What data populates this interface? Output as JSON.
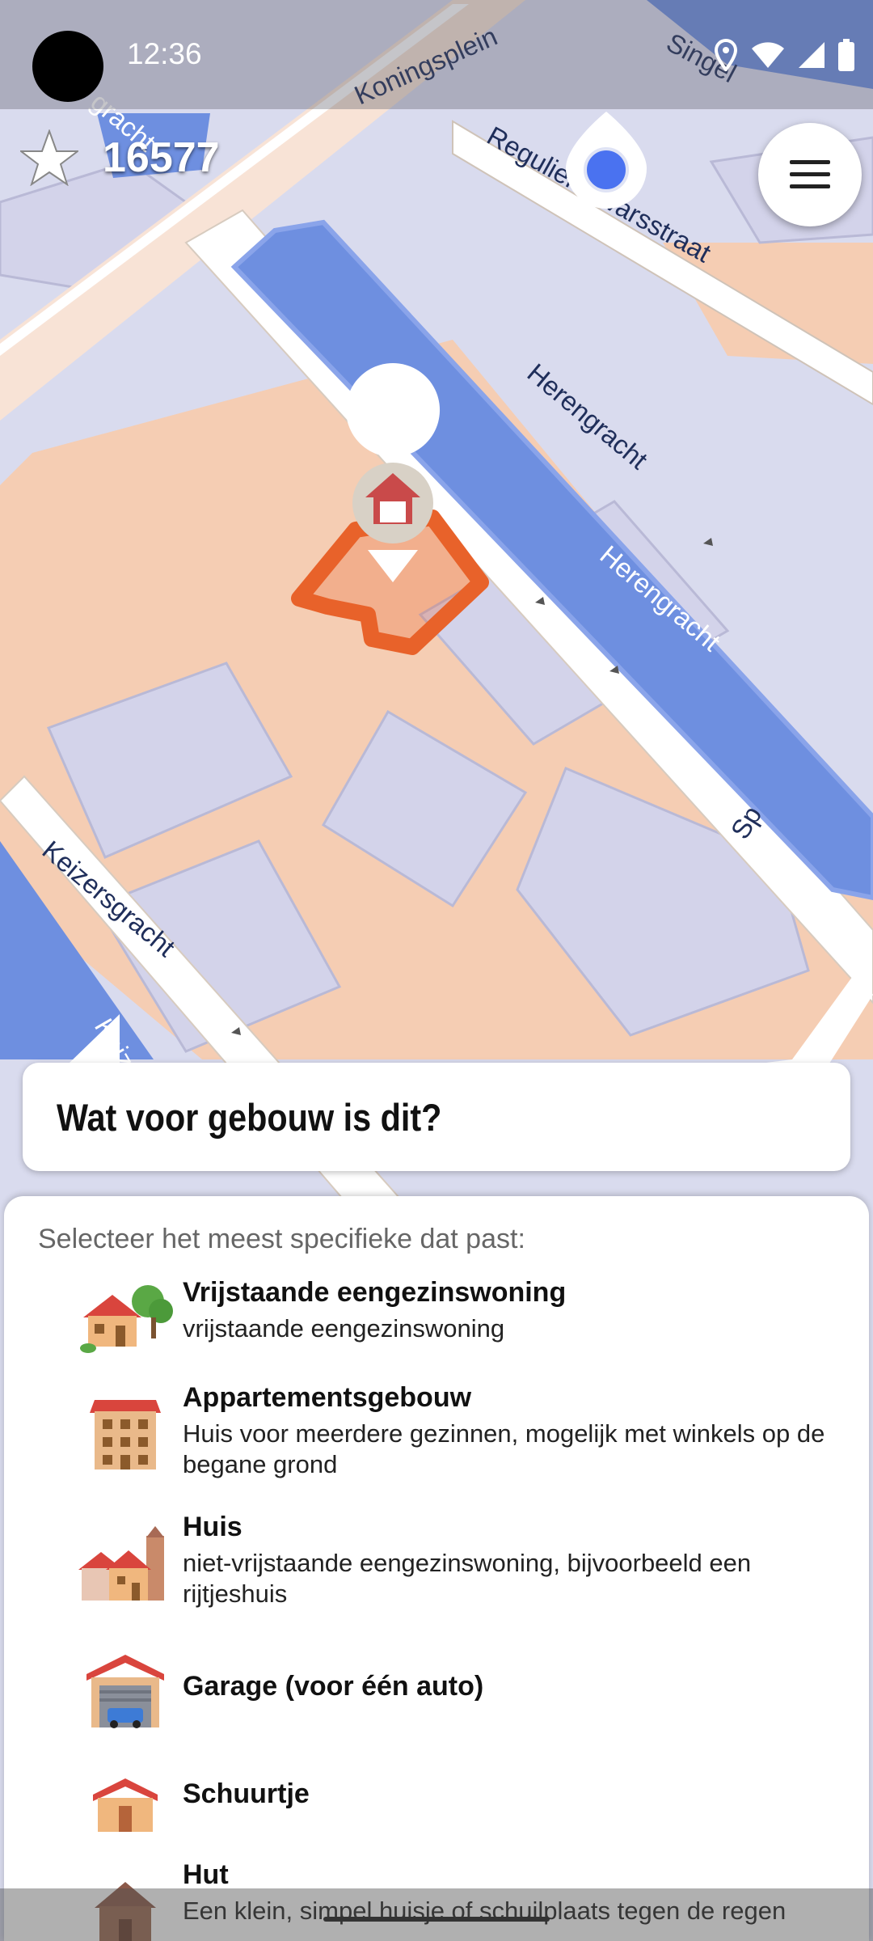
{
  "status": {
    "time": "12:36"
  },
  "points": {
    "value": "16577"
  },
  "map": {
    "streets": {
      "koningsplein": "Koningsplein",
      "singel": "Singel",
      "reguliers": "Reguliersdwarsstraat",
      "herengracht_street": "Herengracht",
      "herengracht_canal": "Herengracht",
      "keizersgracht": "Keizersgracht",
      "reguliersgracht_top": "gracht",
      "keizersgracht_bottom": "Keize",
      "sp_right": "Sp"
    },
    "colors": {
      "water": "#6e8fe0",
      "building": "#f5cdb3",
      "block": "#cfd0e8",
      "road": "#ffffff",
      "highlight": "#e8622a"
    }
  },
  "question": {
    "title": "Wat voor gebouw is dit?"
  },
  "panel": {
    "instruction": "Selecteer het meest specifieke dat past:",
    "options": [
      {
        "title": "Vrijstaande eengezinswoning",
        "desc": "vrijstaande eengezinswoning",
        "icon": "detached-house-icon"
      },
      {
        "title": "Appartementsgebouw",
        "desc": "Huis voor meerdere gezinnen, mogelijk met winkels op de begane grond",
        "icon": "apartment-building-icon"
      },
      {
        "title": "Huis",
        "desc": "niet-vrijstaande eengezinswoning, bijvoorbeeld een rijtjeshuis",
        "icon": "terraced-house-icon"
      },
      {
        "title": "Garage (voor één auto)",
        "desc": "",
        "icon": "garage-icon"
      },
      {
        "title": "Schuurtje",
        "desc": "",
        "icon": "shed-icon"
      },
      {
        "title": "Hut",
        "desc": "Een klein, simpel huisje of schuilplaats tegen de regen",
        "icon": "hut-icon"
      }
    ]
  }
}
